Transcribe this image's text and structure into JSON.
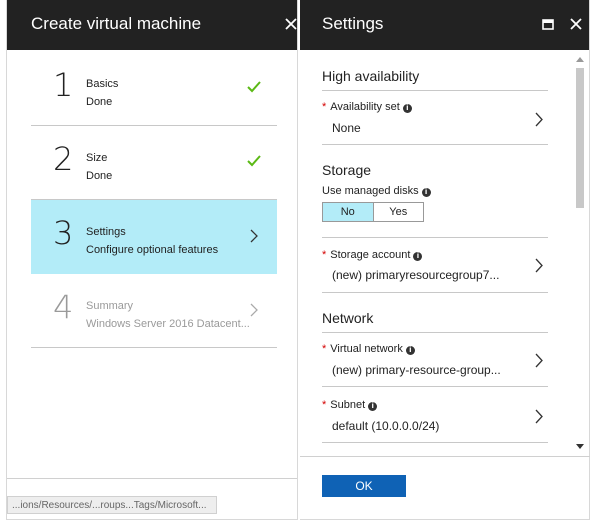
{
  "left_blade": {
    "title": "Create virtual machine",
    "steps": [
      {
        "number": "1",
        "name": "Basics",
        "status": "Done",
        "state": "done"
      },
      {
        "number": "2",
        "name": "Size",
        "status": "Done",
        "state": "done"
      },
      {
        "number": "3",
        "name": "Settings",
        "status": "Configure optional features",
        "state": "active"
      },
      {
        "number": "4",
        "name": "Summary",
        "status": "Windows Server 2016 Datacent...",
        "state": "disabled"
      }
    ],
    "statusbar_text": "...ions/Resources/...roups...Tags/Microsoft..."
  },
  "right_blade": {
    "title": "Settings",
    "sections": {
      "high_availability": {
        "title": "High availability",
        "availability_set": {
          "label": "Availability set",
          "value": "None"
        }
      },
      "storage": {
        "title": "Storage",
        "managed_disks_label": "Use managed disks",
        "managed_disks_options": [
          "No",
          "Yes"
        ],
        "managed_disks_selected": "No",
        "storage_account": {
          "label": "Storage account",
          "value": "(new) primaryresourcegroup7..."
        }
      },
      "network": {
        "title": "Network",
        "virtual_network": {
          "label": "Virtual network",
          "value": "(new) primary-resource-group..."
        },
        "subnet": {
          "label": "Subnet",
          "value": "default (10.0.0.0/24)"
        }
      }
    },
    "ok_label": "OK"
  },
  "colors": {
    "header_bg": "#222222",
    "active_step_bg": "#b3ecf8",
    "check_green": "#5bb915",
    "required_red": "#d40000",
    "ok_button": "#0f62b5"
  }
}
